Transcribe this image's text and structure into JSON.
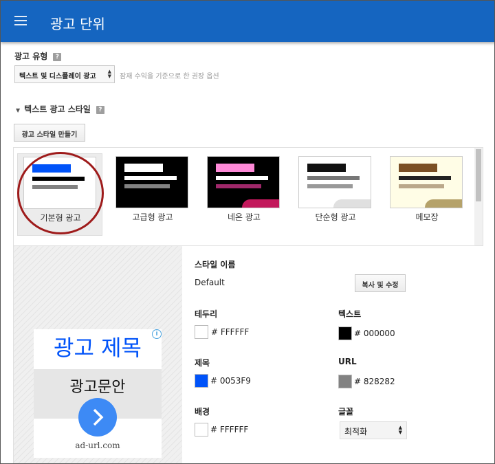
{
  "header": {
    "title": "광고 단위"
  },
  "ad_type": {
    "label": "광고 유형",
    "selected": "텍스트 및 디스플레이 광고",
    "hint": "잠재 수익을 기준으로 한 권장 옵션"
  },
  "text_style": {
    "label": "텍스트 광고 스타일",
    "create_button": "광고 스타일 만들기"
  },
  "styles": [
    {
      "label": "기본형 광고",
      "bg": "#ffffff",
      "title": "#0053F9",
      "text": "#000000",
      "url": "#828282",
      "corner": "",
      "selected": true
    },
    {
      "label": "고급형 광고",
      "bg": "#000000",
      "title": "#ffffff",
      "text": "#ffffff",
      "url": "#828282",
      "corner": "",
      "selected": false
    },
    {
      "label": "네온 광고",
      "bg": "#000000",
      "title": "#ff8ad8",
      "text": "#ffffff",
      "url": "#a0286a",
      "corner": "#c2185b",
      "selected": false
    },
    {
      "label": "단순형 광고",
      "bg": "#ffffff",
      "title": "#111111",
      "text": "#777777",
      "url": "#999999",
      "corner": "#e0e0e0",
      "selected": false
    },
    {
      "label": "메모장",
      "bg": "#fffde6",
      "title": "#7a4f24",
      "text": "#222222",
      "url": "#bba88a",
      "corner": "#b5a26a",
      "selected": false
    }
  ],
  "preview": {
    "title": "광고 제목",
    "body": "광고문안",
    "url": "ad-url.com",
    "info_icon": "i"
  },
  "details": {
    "style_name_label": "스타일 이름",
    "style_name_value": "Default",
    "copy_edit_button": "복사 및 수정",
    "border": {
      "label": "테두리",
      "hex": "# FFFFFF",
      "color": "#FFFFFF"
    },
    "text": {
      "label": "텍스트",
      "hex": "# 000000",
      "color": "#000000"
    },
    "title": {
      "label": "제목",
      "hex": "# 0053F9",
      "color": "#0053F9"
    },
    "url": {
      "label": "URL",
      "hex": "# 828282",
      "color": "#828282"
    },
    "background": {
      "label": "배경",
      "hex": "# FFFFFF",
      "color": "#FFFFFF"
    },
    "font": {
      "label": "글꼴",
      "value": "최적화"
    }
  },
  "colors": {
    "appbar": "#1565c0",
    "highlight_circle": "#9e1b1b",
    "arrow_button": "#3d8af5"
  }
}
